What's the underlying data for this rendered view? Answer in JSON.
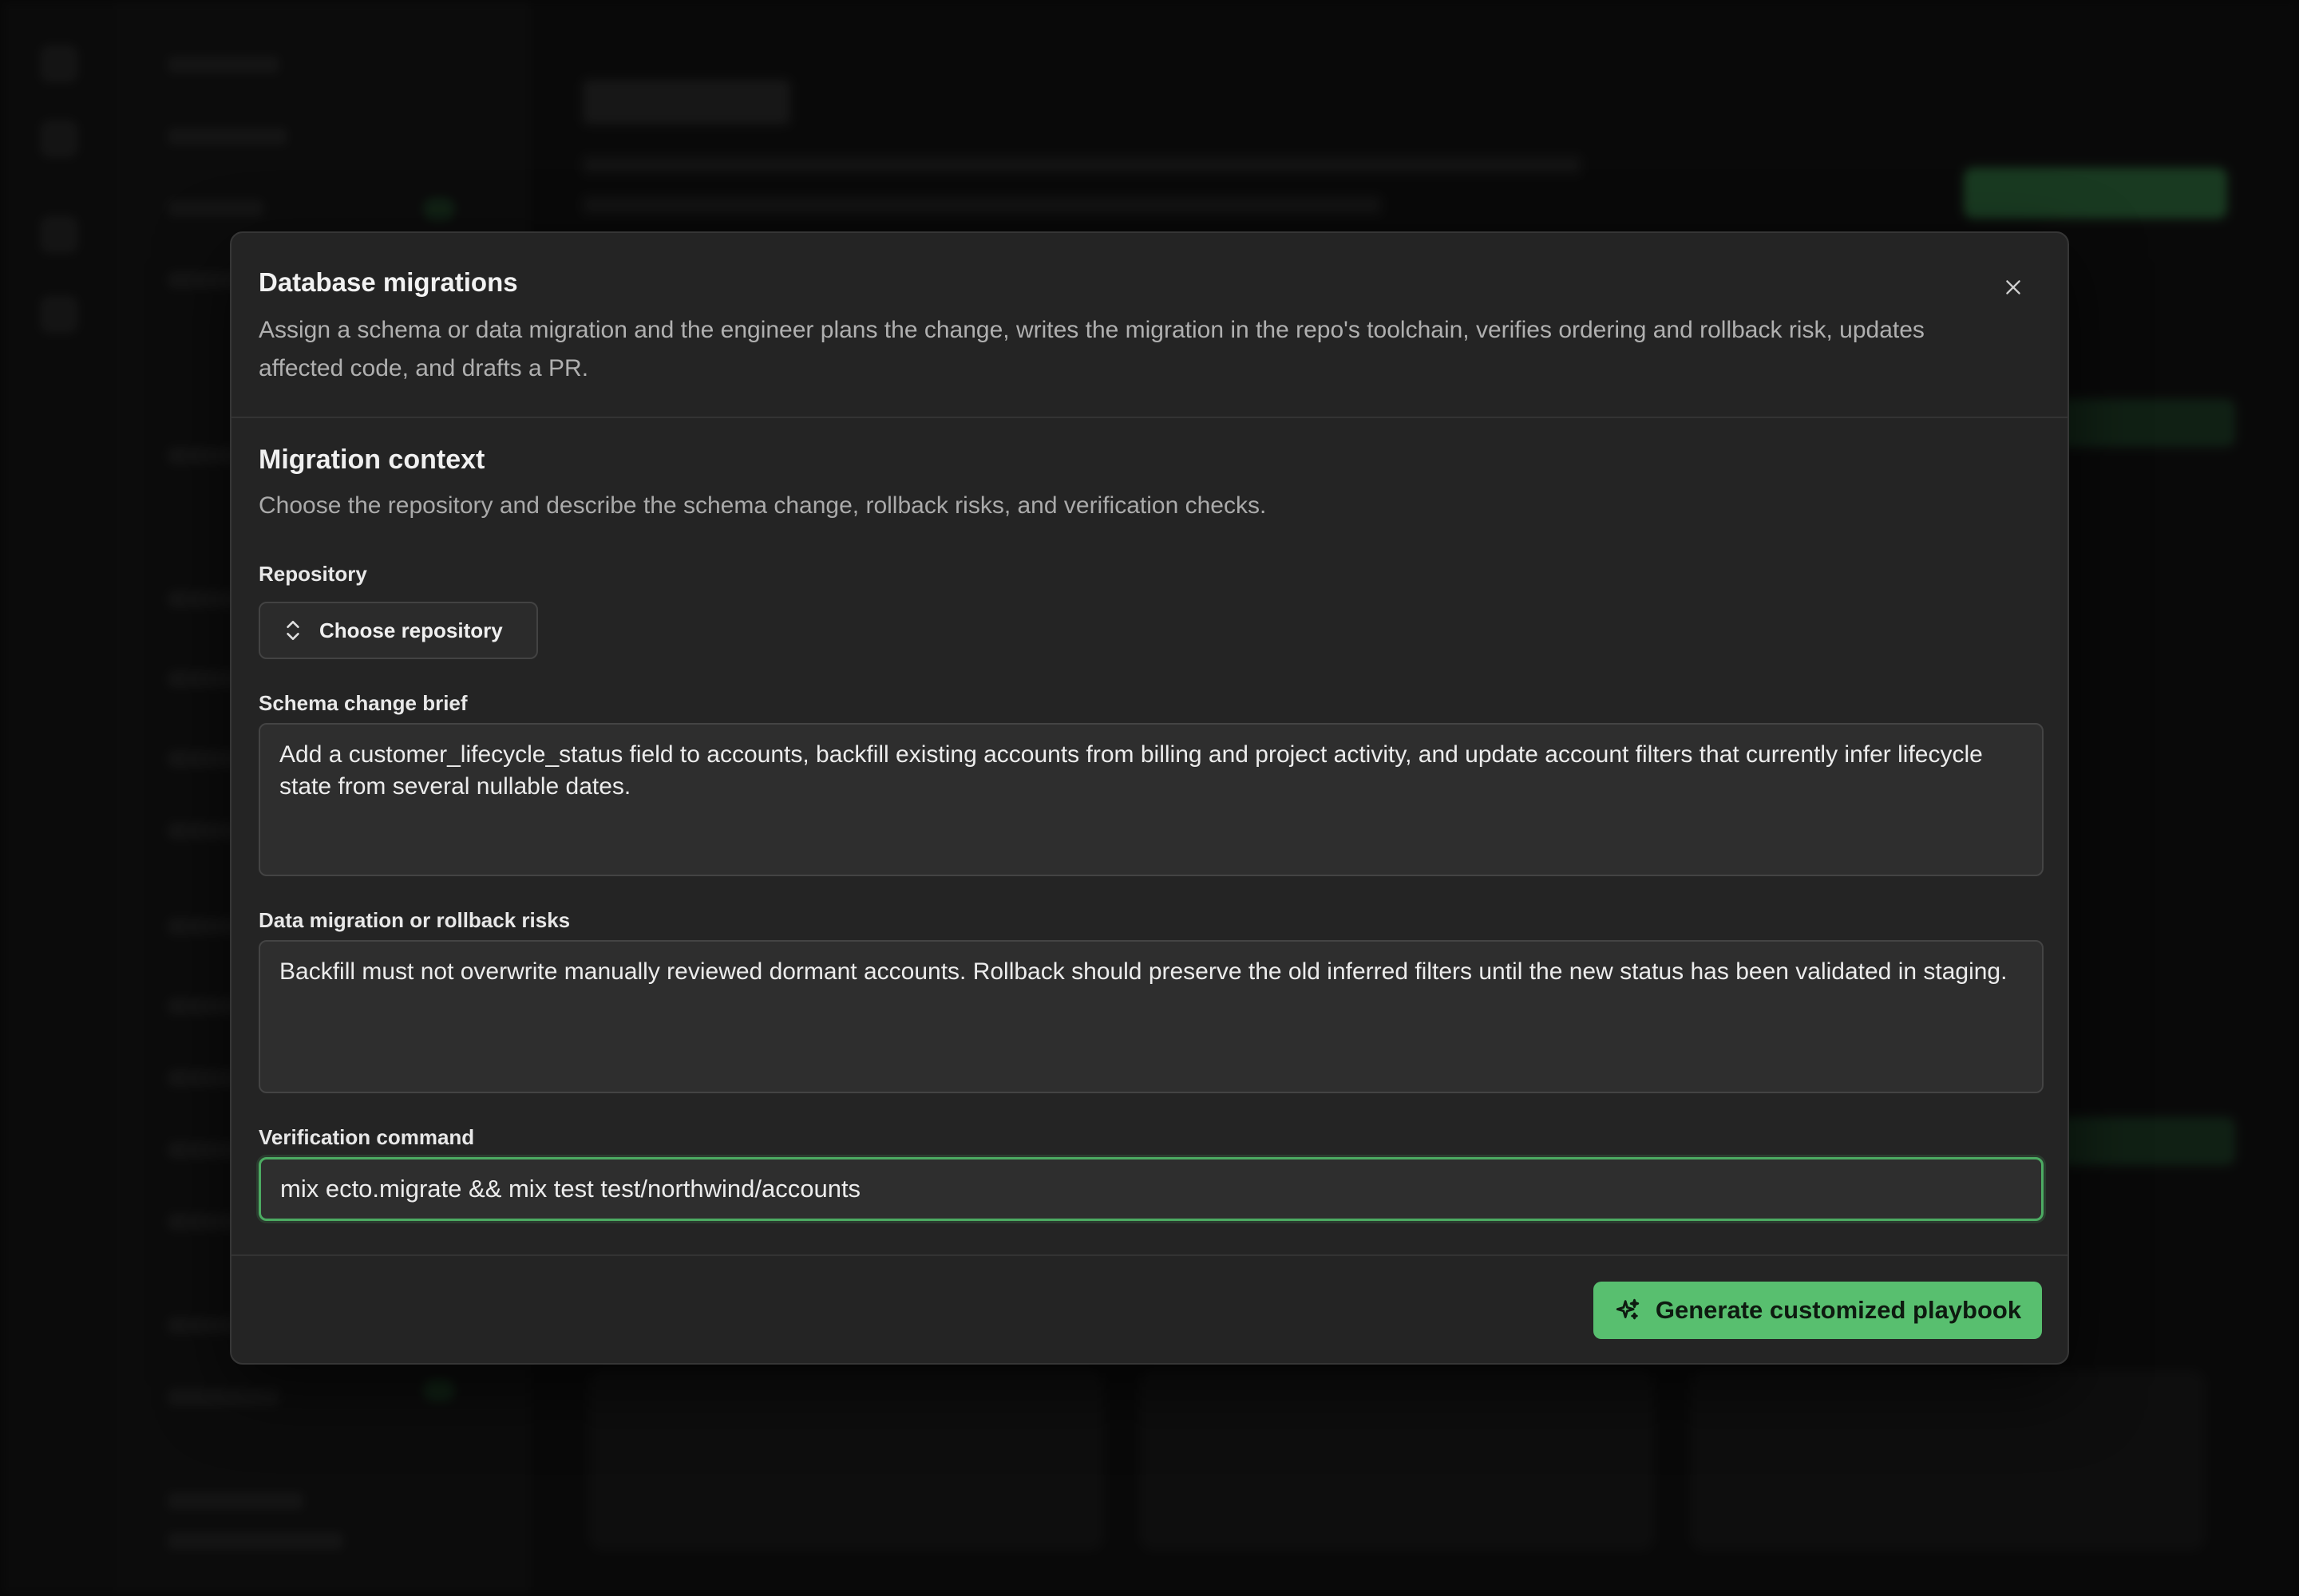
{
  "modal": {
    "title": "Database migrations",
    "description": "Assign a schema or data migration and the engineer plans the change, writes the migration in the repo's toolchain, verifies ordering and rollback risk, updates affected code, and drafts a PR.",
    "close_icon": "close-icon"
  },
  "section": {
    "title": "Migration context",
    "description": "Choose the repository and describe the schema change, rollback risks, and verification checks."
  },
  "repository": {
    "label": "Repository",
    "button_label": "Choose repository",
    "icon": "chevron-up-down-icon"
  },
  "schema_brief": {
    "label": "Schema change brief",
    "value": "Add a customer_lifecycle_status field to accounts, backfill existing accounts from billing and project activity, and update account filters that currently infer lifecycle state from several nullable dates."
  },
  "rollback_risks": {
    "label": "Data migration or rollback risks",
    "value": "Backfill must not overwrite manually reviewed dormant accounts. Rollback should preserve the old inferred filters until the new status has been validated in staging."
  },
  "verification": {
    "label": "Verification command",
    "value": "mix ecto.migrate && mix test test/northwind/accounts"
  },
  "footer": {
    "generate_label": "Generate customized playbook",
    "generate_icon": "sparkles-icon"
  },
  "colors": {
    "accent": "#58bf6f",
    "focus_ring": "#4cab62",
    "modal_bg": "#242424",
    "backdrop": "#0d0d0d"
  }
}
